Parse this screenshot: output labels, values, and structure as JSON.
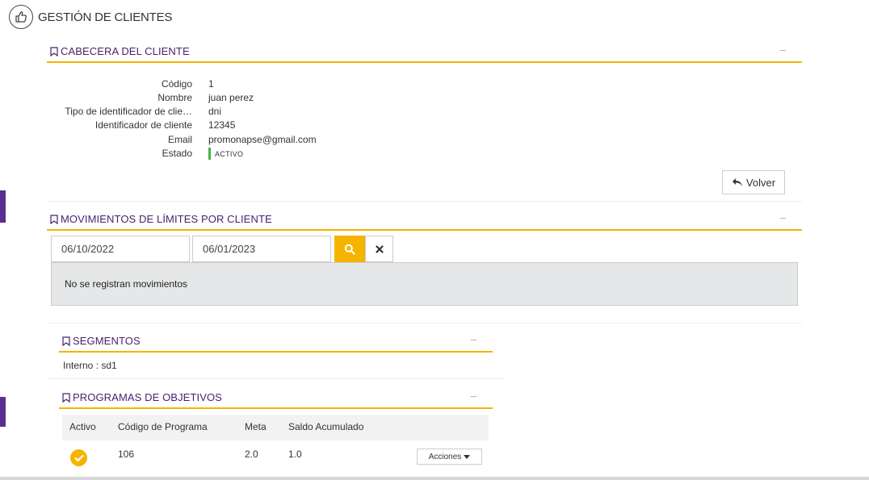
{
  "page": {
    "title": "GESTIÓN DE CLIENTES",
    "icon": "thumbs-up-icon"
  },
  "colors": {
    "accent": "#f5b400",
    "brand": "#5b2d91",
    "heading": "#4a1f6a",
    "status_active": "#4caf50"
  },
  "header_section": {
    "title": "CABECERA DEL CLIENTE",
    "collapse": "–",
    "fields": [
      {
        "label": "Código",
        "value": "1"
      },
      {
        "label": "Nombre",
        "value": "juan perez"
      },
      {
        "label": "Tipo de identificador de clie…",
        "value": "dni"
      },
      {
        "label": "Identificador de cliente",
        "value": "12345"
      },
      {
        "label": "Email",
        "value": "promonapse@gmail.com"
      }
    ],
    "status_label": "Estado",
    "status_value": "ACTIVO",
    "back_button": "Volver"
  },
  "movements_section": {
    "title": "MOVIMIENTOS DE LÍMITES POR CLIENTE",
    "collapse": "–",
    "date_from": "06/10/2022",
    "date_to": "06/01/2023",
    "search_icon": "search-icon",
    "clear_icon": "close-icon",
    "empty_message": "No se registran movimientos"
  },
  "segments_section": {
    "title": "SEGMENTOS",
    "collapse": "–",
    "text": "Interno : sd1"
  },
  "programs_section": {
    "title": "PROGRAMAS DE OBJETIVOS",
    "collapse": "–",
    "columns": [
      "Activo",
      "Código de Programa",
      "Meta",
      "Saldo Acumulado"
    ],
    "rows": [
      {
        "active": true,
        "code": "106",
        "meta": "2.0",
        "saldo": "1.0",
        "actions": "Acciones"
      }
    ]
  }
}
